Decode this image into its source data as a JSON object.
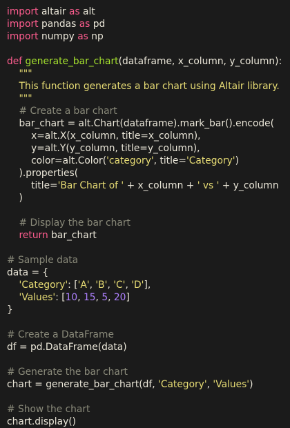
{
  "code": {
    "lines": [
      {
        "tokens": [
          {
            "t": "import",
            "c": "kw"
          },
          {
            "t": " altair ",
            "c": "pl"
          },
          {
            "t": "as",
            "c": "kw"
          },
          {
            "t": " alt",
            "c": "pl"
          }
        ]
      },
      {
        "tokens": [
          {
            "t": "import",
            "c": "kw"
          },
          {
            "t": " pandas ",
            "c": "pl"
          },
          {
            "t": "as",
            "c": "kw"
          },
          {
            "t": " pd",
            "c": "pl"
          }
        ]
      },
      {
        "tokens": [
          {
            "t": "import",
            "c": "kw"
          },
          {
            "t": " numpy ",
            "c": "pl"
          },
          {
            "t": "as",
            "c": "kw"
          },
          {
            "t": " np",
            "c": "pl"
          }
        ]
      },
      {
        "tokens": []
      },
      {
        "tokens": [
          {
            "t": "def",
            "c": "kw"
          },
          {
            "t": " ",
            "c": "pl"
          },
          {
            "t": "generate_bar_chart",
            "c": "fn"
          },
          {
            "t": "(dataframe, x_column, y_column):",
            "c": "pl"
          }
        ]
      },
      {
        "tokens": [
          {
            "t": "    \"\"\"",
            "c": "doc"
          }
        ]
      },
      {
        "tokens": [
          {
            "t": "    This function generates a bar chart using Altair library.",
            "c": "doc"
          }
        ]
      },
      {
        "tokens": [
          {
            "t": "    \"\"\"",
            "c": "doc"
          }
        ]
      },
      {
        "tokens": [
          {
            "t": "    # Create a bar chart",
            "c": "cmt"
          }
        ]
      },
      {
        "tokens": [
          {
            "t": "    bar_chart = alt.Chart(dataframe).mark_bar().encode(",
            "c": "pl"
          }
        ]
      },
      {
        "tokens": [
          {
            "t": "        x=alt.X(x_column, title=x_column),",
            "c": "pl"
          }
        ]
      },
      {
        "tokens": [
          {
            "t": "        y=alt.Y(y_column, title=y_column),",
            "c": "pl"
          }
        ]
      },
      {
        "tokens": [
          {
            "t": "        color=alt.Color(",
            "c": "pl"
          },
          {
            "t": "'category'",
            "c": "str"
          },
          {
            "t": ", title=",
            "c": "pl"
          },
          {
            "t": "'Category'",
            "c": "str"
          },
          {
            "t": ")",
            "c": "pl"
          }
        ]
      },
      {
        "tokens": [
          {
            "t": "    ).properties(",
            "c": "pl"
          }
        ]
      },
      {
        "tokens": [
          {
            "t": "        title=",
            "c": "pl"
          },
          {
            "t": "'Bar Chart of '",
            "c": "str"
          },
          {
            "t": " + x_column + ",
            "c": "pl"
          },
          {
            "t": "' vs '",
            "c": "str"
          },
          {
            "t": " + y_column",
            "c": "pl"
          }
        ]
      },
      {
        "tokens": [
          {
            "t": "    )",
            "c": "pl"
          }
        ]
      },
      {
        "tokens": []
      },
      {
        "tokens": [
          {
            "t": "    # Display the bar chart",
            "c": "cmt"
          }
        ]
      },
      {
        "tokens": [
          {
            "t": "    ",
            "c": "pl"
          },
          {
            "t": "return",
            "c": "kw"
          },
          {
            "t": " bar_chart",
            "c": "pl"
          }
        ]
      },
      {
        "tokens": []
      },
      {
        "tokens": [
          {
            "t": "# Sample data",
            "c": "cmt"
          }
        ]
      },
      {
        "tokens": [
          {
            "t": "data = {",
            "c": "pl"
          }
        ]
      },
      {
        "tokens": [
          {
            "t": "    ",
            "c": "pl"
          },
          {
            "t": "'Category'",
            "c": "str"
          },
          {
            "t": ": [",
            "c": "pl"
          },
          {
            "t": "'A'",
            "c": "str"
          },
          {
            "t": ", ",
            "c": "pl"
          },
          {
            "t": "'B'",
            "c": "str"
          },
          {
            "t": ", ",
            "c": "pl"
          },
          {
            "t": "'C'",
            "c": "str"
          },
          {
            "t": ", ",
            "c": "pl"
          },
          {
            "t": "'D'",
            "c": "str"
          },
          {
            "t": "],",
            "c": "pl"
          }
        ]
      },
      {
        "tokens": [
          {
            "t": "    ",
            "c": "pl"
          },
          {
            "t": "'Values'",
            "c": "str"
          },
          {
            "t": ": [",
            "c": "pl"
          },
          {
            "t": "10",
            "c": "num"
          },
          {
            "t": ", ",
            "c": "pl"
          },
          {
            "t": "15",
            "c": "num"
          },
          {
            "t": ", ",
            "c": "pl"
          },
          {
            "t": "5",
            "c": "num"
          },
          {
            "t": ", ",
            "c": "pl"
          },
          {
            "t": "20",
            "c": "num"
          },
          {
            "t": "]",
            "c": "pl"
          }
        ]
      },
      {
        "tokens": [
          {
            "t": "}",
            "c": "pl"
          }
        ]
      },
      {
        "tokens": []
      },
      {
        "tokens": [
          {
            "t": "# Create a DataFrame",
            "c": "cmt"
          }
        ]
      },
      {
        "tokens": [
          {
            "t": "df = pd.DataFrame(data)",
            "c": "pl"
          }
        ]
      },
      {
        "tokens": []
      },
      {
        "tokens": [
          {
            "t": "# Generate the bar chart",
            "c": "cmt"
          }
        ]
      },
      {
        "tokens": [
          {
            "t": "chart = generate_bar_chart(df, ",
            "c": "pl"
          },
          {
            "t": "'Category'",
            "c": "str"
          },
          {
            "t": ", ",
            "c": "pl"
          },
          {
            "t": "'Values'",
            "c": "str"
          },
          {
            "t": ")",
            "c": "pl"
          }
        ]
      },
      {
        "tokens": []
      },
      {
        "tokens": [
          {
            "t": "# Show the chart",
            "c": "cmt"
          }
        ]
      },
      {
        "tokens": [
          {
            "t": "chart.display()",
            "c": "pl"
          }
        ]
      }
    ]
  },
  "colors": {
    "background": "#1b1b1b",
    "keyword": "#ff5d8f",
    "function": "#a6e22e",
    "string": "#e6db74",
    "number": "#ae81ff",
    "comment": "#8a8a7a",
    "text": "#eae6d8"
  }
}
